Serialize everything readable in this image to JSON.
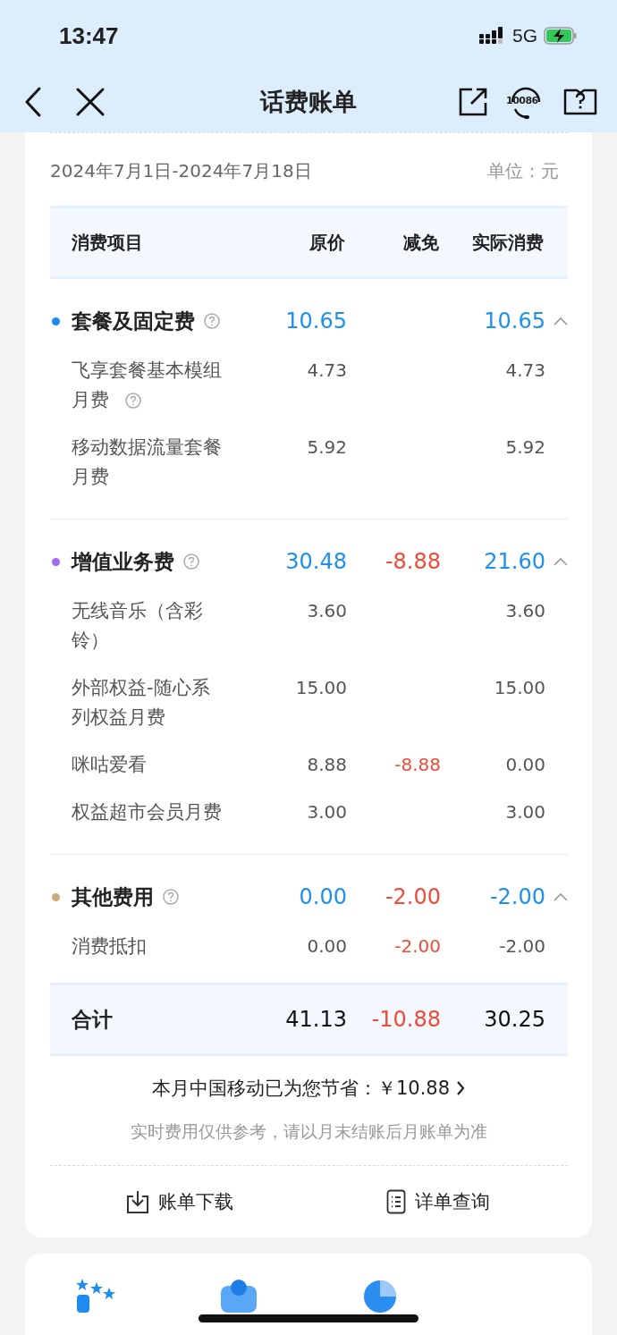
{
  "status_bar": {
    "time": "13:47",
    "network": "5G"
  },
  "nav": {
    "title": "话费账单",
    "hotline": "10086"
  },
  "bill": {
    "period": "2024年7月1日-2024年7月18日",
    "unit": "单位：元",
    "columns": [
      "消费项目",
      "原价",
      "减免",
      "实际消费"
    ],
    "sections": [
      {
        "title": "套餐及固定费",
        "color": "#1a8cf0",
        "help": true,
        "original": "10.65",
        "actual": "10.65",
        "expanded": true,
        "items": [
          {
            "name": "飞享套餐基本模组月费",
            "help": true,
            "original": "4.73",
            "actual": "4.73"
          },
          {
            "name": "移动数据流量套餐月费",
            "help": false,
            "original": "5.92",
            "actual": "5.92"
          }
        ]
      },
      {
        "title": "增值业务费",
        "color": "#a06cf0",
        "help": true,
        "original": "30.48",
        "discount": "-8.88",
        "actual": "21.60",
        "expanded": true,
        "items": [
          {
            "name": "无线音乐（含彩铃）",
            "help": false,
            "original": "3.60",
            "actual": "3.60"
          },
          {
            "name": "外部权益-随心系列权益月费",
            "help": false,
            "original": "15.00",
            "actual": "15.00"
          },
          {
            "name": "咪咕爱看",
            "help": false,
            "original": "8.88",
            "discount": "-8.88",
            "actual": "0.00"
          },
          {
            "name": "权益超市会员月费",
            "help": false,
            "original": "3.00",
            "actual": "3.00"
          }
        ]
      },
      {
        "title": "其他费用",
        "color": "#c9ab7a",
        "help": true,
        "original": "0.00",
        "discount": "-2.00",
        "actual": "-2.00",
        "expanded": true,
        "items": [
          {
            "name": "消费抵扣",
            "help": false,
            "original": "0.00",
            "discount": "-2.00",
            "actual": "-2.00"
          }
        ]
      }
    ],
    "total": {
      "label": "合计",
      "original": "41.13",
      "discount": "-10.88",
      "actual": "30.25"
    },
    "savings": "本月中国移动已为您节省：￥10.88",
    "disclaimer": "实时费用仅供参考，请以月末结账后月账单为准",
    "actions": [
      {
        "kind": "download",
        "label": "账单下载"
      },
      {
        "kind": "details",
        "label": "详单查询"
      }
    ]
  }
}
